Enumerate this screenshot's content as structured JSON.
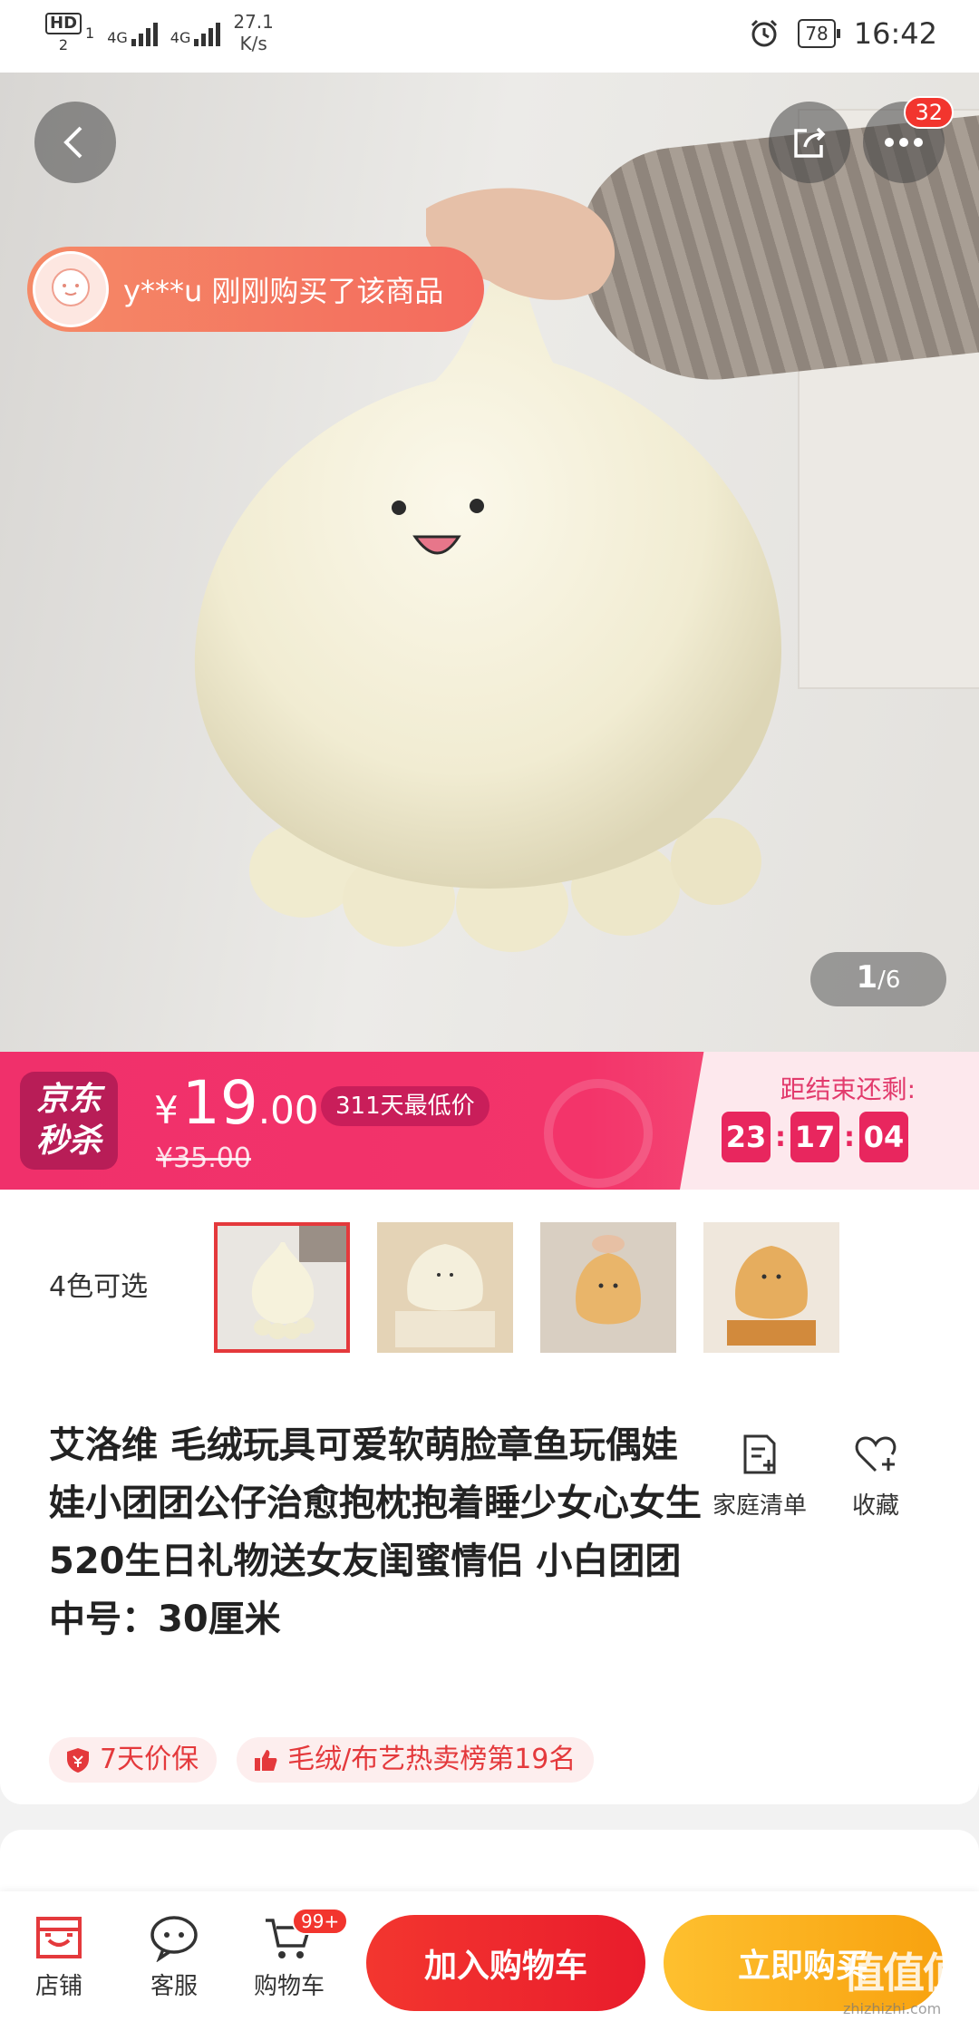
{
  "status_bar": {
    "hd": "HD",
    "sim1": "1",
    "sim2": "2",
    "net1": "4G",
    "net2": "4G",
    "speed_value": "27.1",
    "speed_unit": "K/s",
    "battery": "78",
    "time": "16:42"
  },
  "hero": {
    "more_badge": "32",
    "buyer_notice": "y***u 刚刚购买了该商品",
    "page_current": "1",
    "page_total": "/6"
  },
  "flash_sale": {
    "logo_line1": "京东",
    "logo_line2": "秒杀",
    "currency": "¥",
    "price_int": "19",
    "price_dec": ".00",
    "original_price": "¥35.00",
    "lowest_tag": "311天最低价",
    "countdown_label": "距结束还剩:",
    "hours": "23",
    "minutes": "17",
    "seconds": "04",
    "accent_color": "#f0306b"
  },
  "variants": {
    "label": "4色可选"
  },
  "product": {
    "title": "艾洛维 毛绒玩具可爱软萌脸章鱼玩偶娃娃小团团公仔治愈抱枕抱着睡少女心女生520生日礼物送女友闺蜜情侣 小白团团 中号：30厘米",
    "action_list_label": "家庭清单",
    "action_fav_label": "收藏",
    "tag1": "7天价保",
    "tag2": "毛绒/布艺热卖榜第19名"
  },
  "bottom_bar": {
    "shop_label": "店铺",
    "service_label": "客服",
    "cart_label": "购物车",
    "cart_badge": "99+",
    "add_cart_label": "加入购物车",
    "buy_now_label": "立即购买"
  },
  "watermark": {
    "main": "值值值",
    "sub": "zhizhizhi.com"
  }
}
